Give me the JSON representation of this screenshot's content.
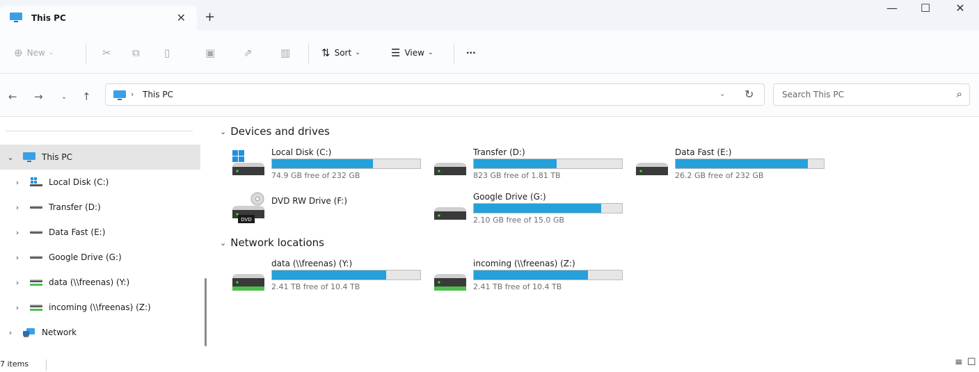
{
  "window": {
    "tab_title": "This PC",
    "tab_close": "✕",
    "new_tab": "+",
    "minimize": "—",
    "maximize": "☐",
    "close": "✕"
  },
  "toolbar": {
    "new_label": "New",
    "sort_label": "Sort",
    "view_label": "View",
    "more_label": "···"
  },
  "address": {
    "breadcrumb_sep": "›",
    "crumb": "This PC",
    "search_placeholder": "Search This PC"
  },
  "sidebar": {
    "items": [
      {
        "label": "This PC",
        "icon": "pc-icon",
        "expander": "⌄",
        "selected": true
      },
      {
        "label": "Local Disk (C:)",
        "icon": "windows-drive-icon",
        "expander": "›"
      },
      {
        "label": "Transfer (D:)",
        "icon": "drive-icon",
        "expander": "›"
      },
      {
        "label": "Data Fast (E:)",
        "icon": "drive-icon",
        "expander": "›"
      },
      {
        "label": "Google Drive (G:)",
        "icon": "drive-icon",
        "expander": "›"
      },
      {
        "label": "data (\\\\freenas) (Y:)",
        "icon": "network-drive-icon",
        "expander": "›"
      },
      {
        "label": "incoming (\\\\freenas) (Z:)",
        "icon": "network-drive-icon",
        "expander": "›"
      },
      {
        "label": "Network",
        "icon": "network-icon",
        "expander": "›"
      }
    ]
  },
  "groups": [
    {
      "title": "Devices and drives",
      "drives": [
        {
          "name": "Local Disk (C:)",
          "free": "74.9 GB free of 232 GB",
          "used_fraction": 0.68,
          "icon": "windows-drive-icon"
        },
        {
          "name": "Transfer (D:)",
          "free": "823 GB free of 1.81 TB",
          "used_fraction": 0.56,
          "icon": "drive-icon"
        },
        {
          "name": "Data Fast (E:)",
          "free": "26.2 GB free of 232 GB",
          "used_fraction": 0.89,
          "icon": "drive-icon"
        },
        {
          "name": "DVD RW Drive (F:)",
          "free": "",
          "used_fraction": null,
          "icon": "dvd-drive-icon",
          "dvd_label": "DVD"
        },
        {
          "name": "Google Drive (G:)",
          "free": "2.10 GB free of 15.0 GB",
          "used_fraction": 0.86,
          "icon": "drive-icon"
        }
      ]
    },
    {
      "title": "Network locations",
      "drives": [
        {
          "name": "data (\\\\freenas) (Y:)",
          "free": "2.41 TB free of 10.4 TB",
          "used_fraction": 0.77,
          "icon": "network-drive-icon"
        },
        {
          "name": "incoming (\\\\freenas) (Z:)",
          "free": "2.41 TB free of 10.4 TB",
          "used_fraction": 0.77,
          "icon": "network-drive-icon"
        }
      ]
    }
  ],
  "status": {
    "items_count": "7 items"
  },
  "colors": {
    "accent": "#26a0da",
    "selected_bg": "#e5e5e5",
    "pc_blue": "#3aa0e6"
  }
}
